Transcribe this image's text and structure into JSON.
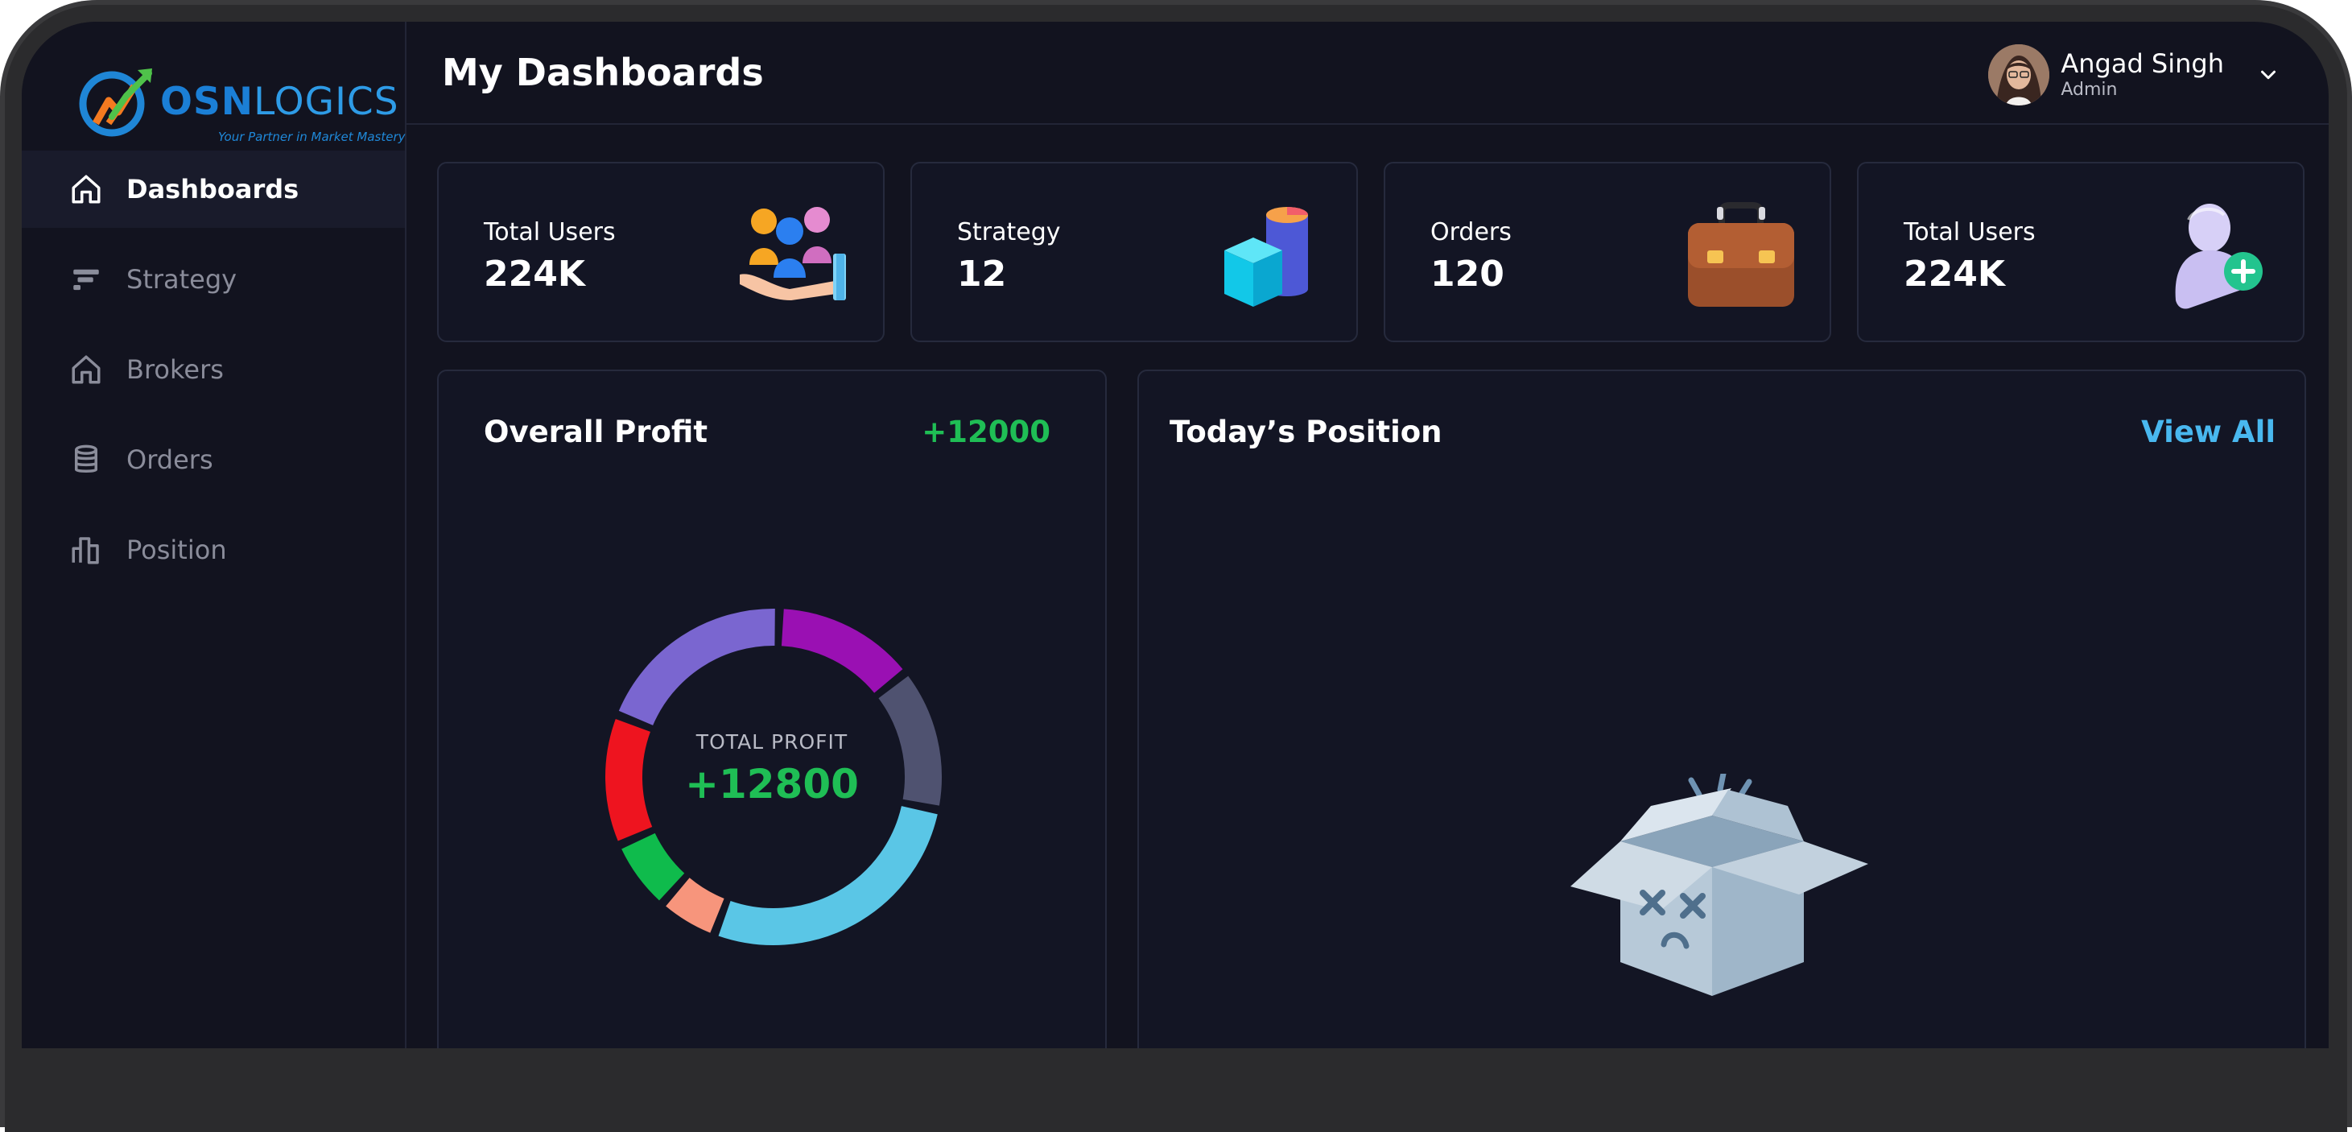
{
  "brand": {
    "name_part1": "OSN",
    "name_part2": "LOGICS",
    "tagline": "Your Partner in Market Mastery"
  },
  "sidebar": {
    "items": [
      {
        "label": "Dashboards",
        "icon": "home-icon",
        "active": true
      },
      {
        "label": "Strategy",
        "icon": "strategy-icon",
        "active": false
      },
      {
        "label": "Brokers",
        "icon": "home-icon",
        "active": false
      },
      {
        "label": "Orders",
        "icon": "database-icon",
        "active": false
      },
      {
        "label": "Position",
        "icon": "bar-chart-icon",
        "active": false
      }
    ]
  },
  "header": {
    "title": "My Dashboards",
    "user": {
      "name": "Angad Singh",
      "role": "Admin"
    }
  },
  "stats": [
    {
      "label": "Total Users",
      "value": "224K",
      "icon": "users-hand-icon"
    },
    {
      "label": "Strategy",
      "value": "12",
      "icon": "cubes-icon"
    },
    {
      "label": "Orders",
      "value": "120",
      "icon": "briefcase-icon"
    },
    {
      "label": "Total Users",
      "value": "224K",
      "icon": "add-user-icon"
    }
  ],
  "profit": {
    "title": "Overall Profit",
    "amount": "+12000",
    "center_label": "TOTAL PROFIT",
    "center_value": "+12800"
  },
  "position": {
    "title": "Today’s Position",
    "view_all": "View All",
    "empty_icon": "empty-box-icon"
  },
  "colors": {
    "background": "#12131f",
    "card": "#131524",
    "positive": "#1fbe55",
    "link": "#49b8ef"
  },
  "chart_data": {
    "type": "pie",
    "values": [
      {
        "value": 12,
        "color": "#9a10b3"
      },
      {
        "value": 12,
        "color": "#4f5270"
      },
      {
        "value": 24,
        "color": "#5ac6e6"
      },
      {
        "value": 5,
        "color": "#f7957c"
      },
      {
        "value": 6,
        "color": "#0fbb4c"
      },
      {
        "value": 11,
        "color": "#ee141f"
      },
      {
        "value": 17,
        "color": "#7a66d0"
      }
    ]
  }
}
